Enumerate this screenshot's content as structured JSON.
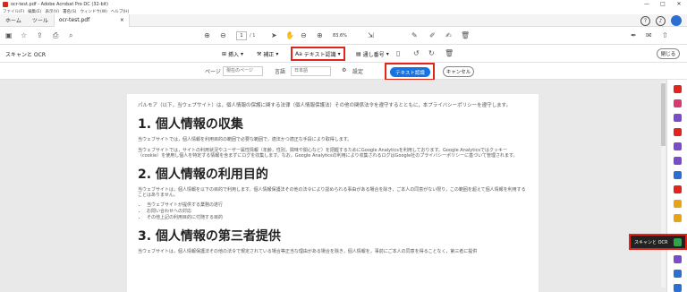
{
  "window": {
    "title": "ocr-test.pdf - Adobe Acrobat Pro DC (32-bit)",
    "controls": [
      "—",
      "□",
      "✕"
    ]
  },
  "menu": [
    "ファイル(F)",
    "編集(E)",
    "表示(V)",
    "署名(S)",
    "ウィンドウ(W)",
    "ヘルプ(H)"
  ],
  "tabs": {
    "home": "ホーム",
    "tools": "ツール",
    "document": "ocr-test.pdf",
    "close": "×"
  },
  "toolbar": {
    "page_current": "1",
    "page_total": "/ 1",
    "zoom": "83.6%"
  },
  "scan": {
    "label": "スキャンと OCR",
    "insert": "挿入",
    "correct": "補正",
    "recognize_text": "テキスト認識",
    "bates": "通し番号",
    "close": "閉じる"
  },
  "options": {
    "page_label": "ページ",
    "page_value": "現在のページ",
    "language_label": "言語",
    "language_value": "日本語",
    "settings_label": "設定",
    "recognize_button": "テキスト認識",
    "cancel_button": "キャンセル"
  },
  "document": {
    "intro": "パルモア（以下，当ウェブサイト）は，個人情報の保護に関する法律（個人情報保護法）その他の関係法令を遵守するとともに，本プライバシーポリシーを遵守します。",
    "h1": "1. 個人情報の収集",
    "p1": "当ウェブサイトでは，個人情報を利用目的の範囲で必要な範囲で，適法かつ適正な手段により取得します。",
    "p2": "当ウェブサイトでは，サイトの利用状況やユーザー属性情報（年齢，性別，興味や関心など）を把握するためにGoogle Analyticsを利用しております。Google Analyticsではクッキー（cookie）を使用し個人を特定する情報を含まずにログを収集します。なお，Google Analyticsの利用により収集されるログはGoogle社のプライバシーポリシーに基づいて管理されます。",
    "h2": "2. 個人情報の利用目的",
    "p3": "当ウェブサイトは，個人情報を以下の目的で利用します。個人情報保護法その他の法令により認められる事由がある場合を除き，ご本人の同意がない限り，この範囲を超えて個人情報を利用することはありません。",
    "list": [
      "当ウェブサイトが提供する業務の遂行",
      "お問い合わせへの対応",
      "その他上記の利用目的に付随する目的"
    ],
    "h3": "3. 個人情報の第三者提供",
    "p4": "当ウェブサイトは，個人情報保護法その他の法令で規定されている場合等正当な理由がある場合を除き，個人情報を，事前にご本人の同意を得ることなく，第三者に提供"
  },
  "right_panel": {
    "tooltip": "スキャンと OCR"
  },
  "colors": {
    "accent": "#1473e6",
    "highlight": "#e1251b"
  }
}
